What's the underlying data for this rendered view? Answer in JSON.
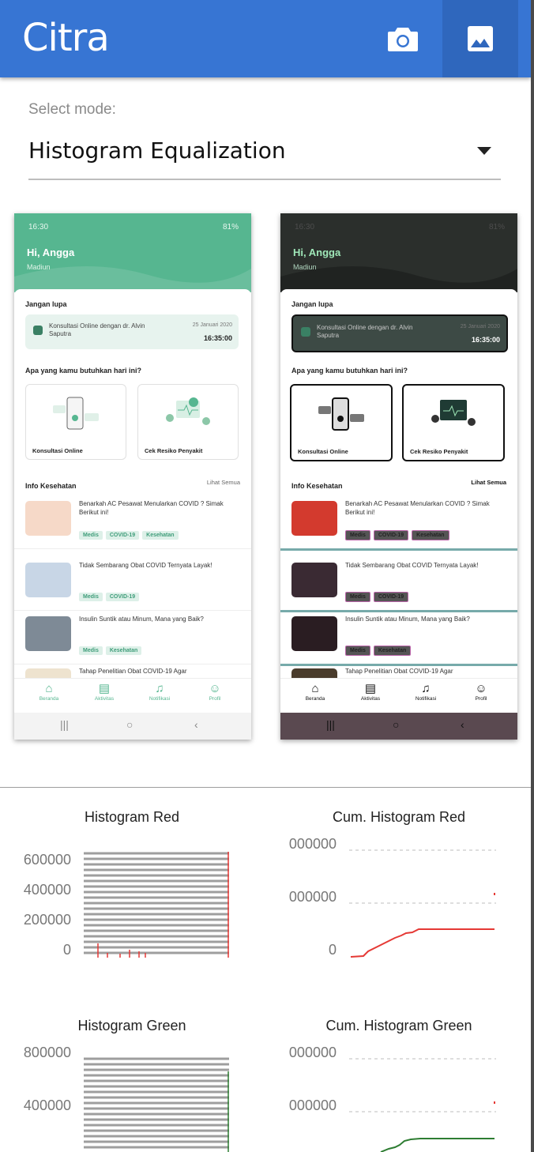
{
  "appbar": {
    "title": "Citra",
    "camera_icon": "camera-icon",
    "gallery_icon": "image-icon"
  },
  "mode": {
    "label": "Select mode:",
    "value": "Histogram Equalization"
  },
  "phone": {
    "time": "16:30",
    "battery": "81%",
    "greeting": "Hi, Angga",
    "location": "Madiun",
    "reminder_title": "Jangan lupa",
    "reminder_text": "Konsultasi Online dengan dr. Alvin Saputra",
    "reminder_date": "25 Januari 2020",
    "reminder_time": "16:35:00",
    "needs_title": "Apa yang kamu butuhkan hari ini?",
    "services": [
      "Konsultasi Online",
      "Cek Resiko Penyakit"
    ],
    "info_title": "Info Kesehatan",
    "see_all": "Lihat Semua",
    "news": [
      {
        "title": "Benarkah AC Pesawat Menularkan COVID ? Simak Berikut ini!",
        "tags": [
          "Medis",
          "COVID-19",
          "Kesehatan"
        ]
      },
      {
        "title": "Tidak Sembarang Obat COVID Ternyata Layak!",
        "tags": [
          "Medis",
          "COVID-19"
        ]
      },
      {
        "title": "Insulin Suntik atau Minum, Mana yang Baik?",
        "tags": [
          "Medis",
          "Kesehatan"
        ]
      },
      {
        "title": "Tahap Penelitian Obat COVID-19 Agar",
        "tags": []
      }
    ],
    "nav": [
      "Beranda",
      "Aktivitas",
      "Notifikasi",
      "Profil"
    ]
  },
  "charts": {
    "red": {
      "title": "Histogram Red",
      "yticks": [
        "600000",
        "400000",
        "200000",
        "0"
      ],
      "color": "#e53935"
    },
    "cum_red": {
      "title": "Cum. Histogram Red",
      "yticks": [
        "000000",
        "000000",
        "0"
      ],
      "color": "#e53935"
    },
    "green": {
      "title": "Histogram Green",
      "yticks": [
        "800000",
        "400000"
      ],
      "color": "#2e7d32"
    },
    "cum_green": {
      "title": "Cum. Histogram Green",
      "yticks": [
        "000000",
        "000000"
      ],
      "color": "#2e7d32"
    }
  }
}
